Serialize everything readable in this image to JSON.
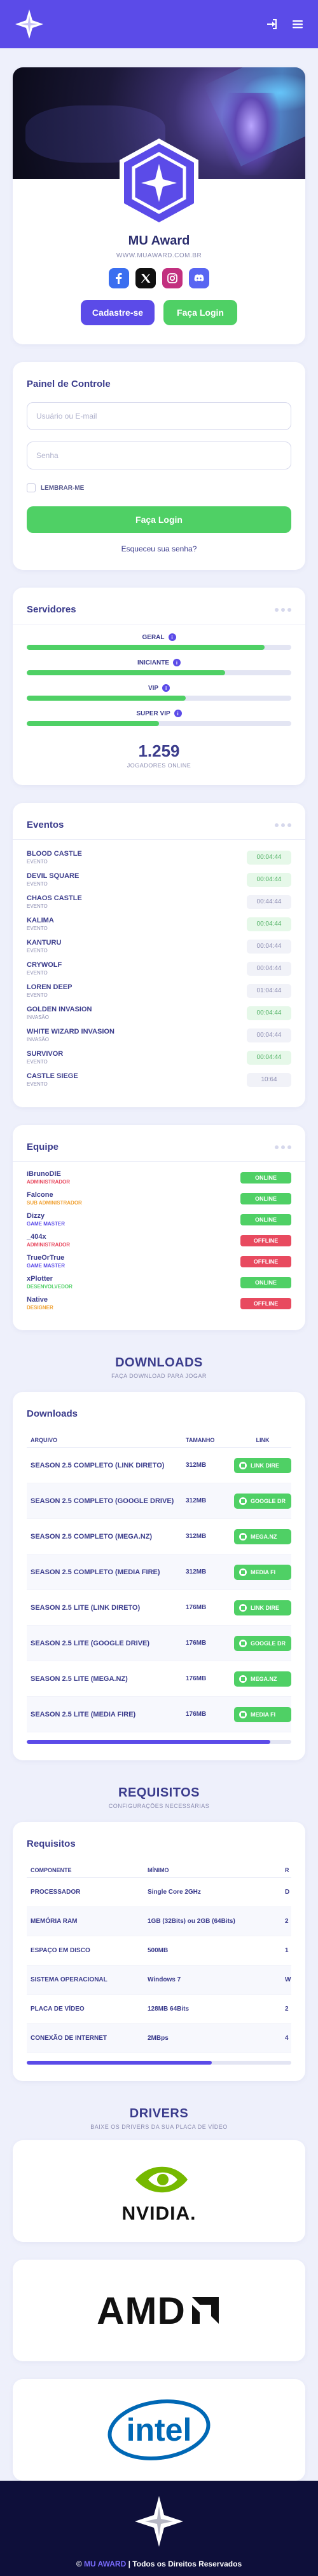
{
  "colors": {
    "brand": "#5b4be8",
    "success": "#4fd065",
    "danger": "#e84a5f",
    "dark": "#0e0f3a"
  },
  "header": {
    "login_icon": "login-icon",
    "menu_icon": "menu-icon"
  },
  "hero": {
    "title": "MU Award",
    "url": "WWW.MUAWARD.COM.BR",
    "socials": [
      "facebook-icon",
      "x-icon",
      "instagram-icon",
      "discord-icon"
    ],
    "register_label": "Cadastre-se",
    "login_label": "Faça Login"
  },
  "control_panel": {
    "title": "Painel de Controle",
    "user_placeholder": "Usuário ou E-mail",
    "password_placeholder": "Senha",
    "remember_label": "LEMBRAR-ME",
    "login_button": "Faça Login",
    "forgot": "Esqueceu sua senha?"
  },
  "servers": {
    "title": "Servidores",
    "items": [
      {
        "name": "GERAL",
        "load": 0.9
      },
      {
        "name": "INICIANTE",
        "load": 0.75
      },
      {
        "name": "VIP",
        "load": 0.6
      },
      {
        "name": "SUPER VIP",
        "load": 0.5
      }
    ],
    "players_count": "1.259",
    "players_label": "JOGADORES ONLINE"
  },
  "events": {
    "title": "Eventos",
    "items": [
      {
        "name": "BLOOD CASTLE",
        "type": "EVENTO",
        "time": "00:04:44",
        "active": true
      },
      {
        "name": "DEVIL SQUARE",
        "type": "EVENTO",
        "time": "00:04:44",
        "active": true
      },
      {
        "name": "CHAOS CASTLE",
        "type": "EVENTO",
        "time": "00:44:44",
        "active": false
      },
      {
        "name": "KALIMA",
        "type": "EVENTO",
        "time": "00:04:44",
        "active": true
      },
      {
        "name": "KANTURU",
        "type": "EVENTO",
        "time": "00:04:44",
        "active": false
      },
      {
        "name": "CRYWOLF",
        "type": "EVENTO",
        "time": "00:04:44",
        "active": false
      },
      {
        "name": "LOREN DEEP",
        "type": "EVENTO",
        "time": "01:04:44",
        "active": false
      },
      {
        "name": "GOLDEN INVASION",
        "type": "INVASÃO",
        "time": "00:04:44",
        "active": true
      },
      {
        "name": "WHITE WIZARD INVASION",
        "type": "INVASÃO",
        "time": "00:04:44",
        "active": false
      },
      {
        "name": "SURVIVOR",
        "type": "EVENTO",
        "time": "00:04:44",
        "active": true
      },
      {
        "name": "CASTLE SIEGE",
        "type": "EVENTO",
        "time": "10:64",
        "active": false
      }
    ]
  },
  "staff": {
    "title": "Equipe",
    "items": [
      {
        "name": "iBrunoDIE",
        "role": "ADMINISTRADOR",
        "role_color": "#e84a5f",
        "status": "ONLINE",
        "online": true
      },
      {
        "name": "Falcone",
        "role": "SUB ADMINISTRADOR",
        "role_color": "#f0a030",
        "status": "ONLINE",
        "online": true
      },
      {
        "name": "Dizzy",
        "role": "GAME MASTER",
        "role_color": "#5b4be8",
        "status": "ONLINE",
        "online": true
      },
      {
        "name": "_404x",
        "role": "ADMINISTRADOR",
        "role_color": "#e84a5f",
        "status": "OFFLINE",
        "online": false
      },
      {
        "name": "TrueOrTrue",
        "role": "GAME MASTER",
        "role_color": "#5b4be8",
        "status": "OFFLINE",
        "online": false
      },
      {
        "name": "xPlotter",
        "role": "DESENVOLVEDOR",
        "role_color": "#4fd065",
        "status": "ONLINE",
        "online": true
      },
      {
        "name": "Native",
        "role": "DESIGNER",
        "role_color": "#f0a030",
        "status": "OFFLINE",
        "online": false
      }
    ]
  },
  "downloads_section": {
    "title": "DOWNLOADS",
    "subtitle": "FAÇA DOWNLOAD PARA JOGAR"
  },
  "downloads": {
    "title": "Downloads",
    "columns": [
      "ARQUIVO",
      "TAMANHO",
      "LINK"
    ],
    "items": [
      {
        "file": "SEASON 2.5 COMPLETO (LINK DIRETO)",
        "size": "312MB",
        "link": "LINK DIRE",
        "icon": "download-icon"
      },
      {
        "file": "SEASON 2.5 COMPLETO (GOOGLE DRIVE)",
        "size": "312MB",
        "link": "GOOGLE DR",
        "icon": "drive-icon"
      },
      {
        "file": "SEASON 2.5 COMPLETO (MEGA.NZ)",
        "size": "312MB",
        "link": "MEGA.NZ",
        "icon": "mega-icon"
      },
      {
        "file": "SEASON 2.5 COMPLETO (MEDIA FIRE)",
        "size": "312MB",
        "link": "MEDIA FI",
        "icon": "mediafire-icon"
      },
      {
        "file": "SEASON 2.5 LITE (LINK DIRETO)",
        "size": "176MB",
        "link": "LINK DIRE",
        "icon": "download-icon"
      },
      {
        "file": "SEASON 2.5 LITE (GOOGLE DRIVE)",
        "size": "176MB",
        "link": "GOOGLE DR",
        "icon": "drive-icon"
      },
      {
        "file": "SEASON 2.5 LITE (MEGA.NZ)",
        "size": "176MB",
        "link": "MEGA.NZ",
        "icon": "mega-icon"
      },
      {
        "file": "SEASON 2.5 LITE (MEDIA FIRE)",
        "size": "176MB",
        "link": "MEDIA FI",
        "icon": "mediafire-icon"
      }
    ]
  },
  "requirements_section": {
    "title": "REQUISITOS",
    "subtitle": "CONFIGURAÇÕES NECESSÁRIAS"
  },
  "requirements": {
    "title": "Requisitos",
    "columns": [
      "COMPONENTE",
      "MÍNIMO",
      "R"
    ],
    "items": [
      {
        "component": "PROCESSADOR",
        "min": "Single Core 2GHz",
        "rec": "D"
      },
      {
        "component": "MEMÓRIA RAM",
        "min": "1GB (32Bits) ou 2GB (64Bits)",
        "rec": "2"
      },
      {
        "component": "ESPAÇO EM DISCO",
        "min": "500MB",
        "rec": "1"
      },
      {
        "component": "SISTEMA OPERACIONAL",
        "min": "Windows 7",
        "rec": "W"
      },
      {
        "component": "PLACA DE VÍDEO",
        "min": "128MB 64Bits",
        "rec": "2"
      },
      {
        "component": "CONEXÃO DE INTERNET",
        "min": "2MBps",
        "rec": "4"
      }
    ]
  },
  "drivers_section": {
    "title": "DRIVERS",
    "subtitle": "BAIXE OS DRIVERS DA SUA PLACA DE VÍDEO"
  },
  "drivers": [
    {
      "brand": "NVIDIA.",
      "logo": "nvidia-logo"
    },
    {
      "brand": "AMD",
      "logo": "amd-logo"
    },
    {
      "brand": "intel",
      "logo": "intel-logo"
    }
  ],
  "footer": {
    "brand": "MU AWARD",
    "rights": "| Todos os Direitos Reservados",
    "copyright": "©"
  }
}
